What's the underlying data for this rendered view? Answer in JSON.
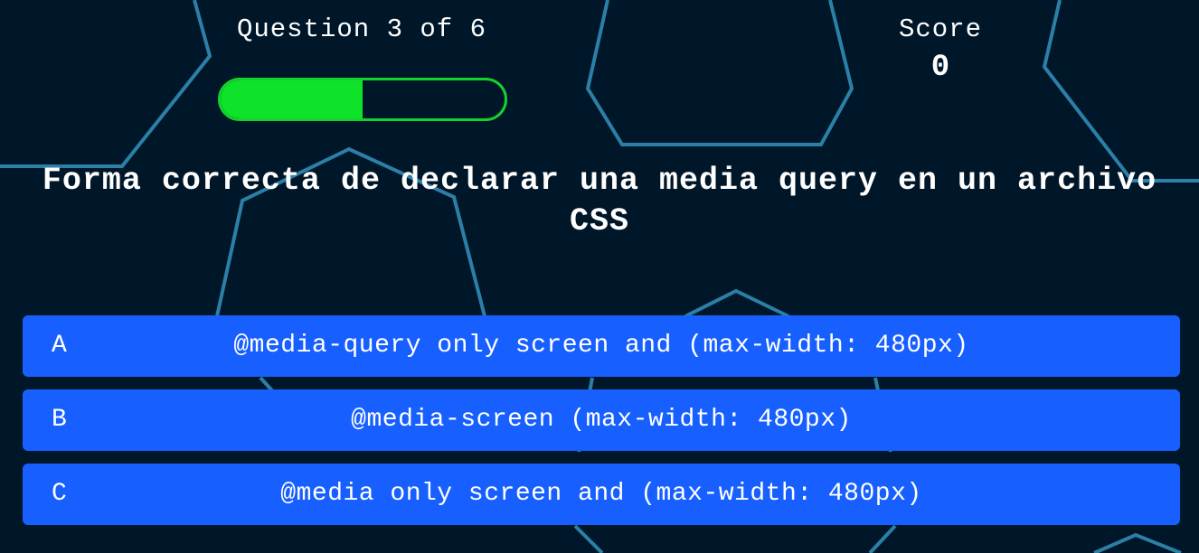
{
  "header": {
    "question_counter": "Question 3 of 6",
    "progress_fraction": 0.5,
    "score_label": "Score",
    "score_value": "0"
  },
  "question": {
    "text": "Forma correcta de declarar una media query en un archivo CSS"
  },
  "answers": [
    {
      "letter": "A",
      "text": "@media-query only screen and (max-width: 480px)"
    },
    {
      "letter": "B",
      "text": "@media-screen (max-width: 480px)"
    },
    {
      "letter": "C",
      "text": "@media only screen and (max-width: 480px)"
    }
  ],
  "colors": {
    "background": "#00172a",
    "hexagon_outline": "#2c7fa6",
    "progress_fill": "#0ee32a",
    "progress_border": "#14d22d",
    "answer_button": "#1760ff",
    "text": "#ffffff"
  }
}
